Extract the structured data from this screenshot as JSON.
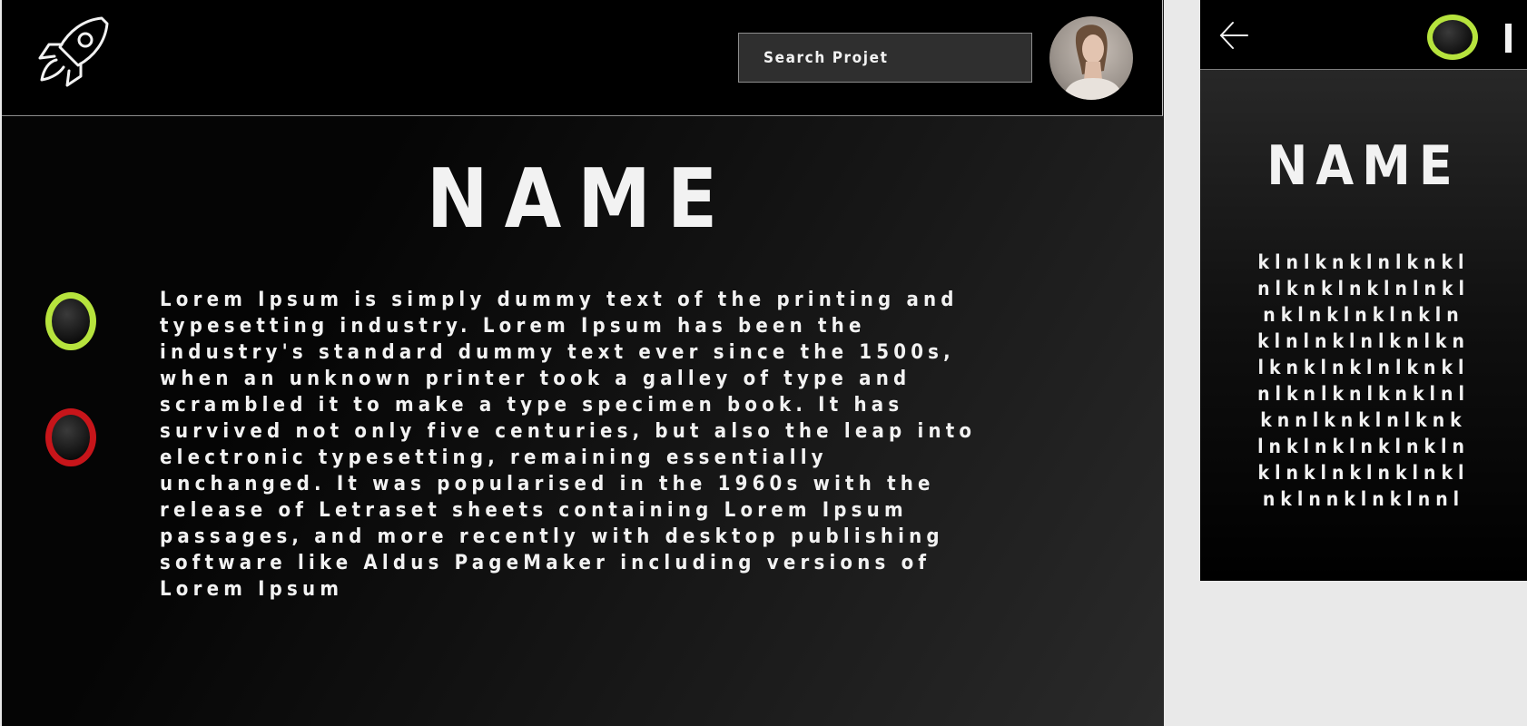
{
  "main": {
    "search": {
      "placeholder": "Search Projet"
    },
    "title": "NAME",
    "body_text": "Lorem Ipsum is simply dummy text of the printing and typesetting industry. Lorem Ipsum has been the industry's standard dummy text ever since the 1500s, when an unknown printer took a galley of type and scrambled it to make a type specimen book. It has survived not only five centuries, but also the leap into electronic typesetting, remaining essentially unchanged. It was popularised in the 1960s with the release of Letraset sheets containing Lorem Ipsum passages, and more recently with desktop publishing software like Aldus PageMaker including versions of Lorem Ipsum",
    "icons": {
      "logo": "rocket-icon",
      "status_1": "green-ring-icon",
      "status_2": "red-ring-icon"
    }
  },
  "mobile": {
    "title": "NAME",
    "body_lines": [
      "klnlknklnlknkl",
      "nlknklnklnlnkl",
      "nklnklnklnkln",
      "klnlnklnlknlkn",
      "lknklnklnlknkl",
      "nlknlknlknklnl",
      "knnlknklnlknk",
      "lnklnklnklnkln",
      "klnklnklnklnkl",
      "nklnnklnklnnl"
    ],
    "icons": {
      "back": "back-arrow-icon",
      "status": "green-ring-icon",
      "menu": "menu-bar-icon"
    }
  },
  "colors": {
    "accent_green": "#b6e33d",
    "accent_red": "#c7151a",
    "background": "#000000",
    "text": "#f2f2f2"
  }
}
